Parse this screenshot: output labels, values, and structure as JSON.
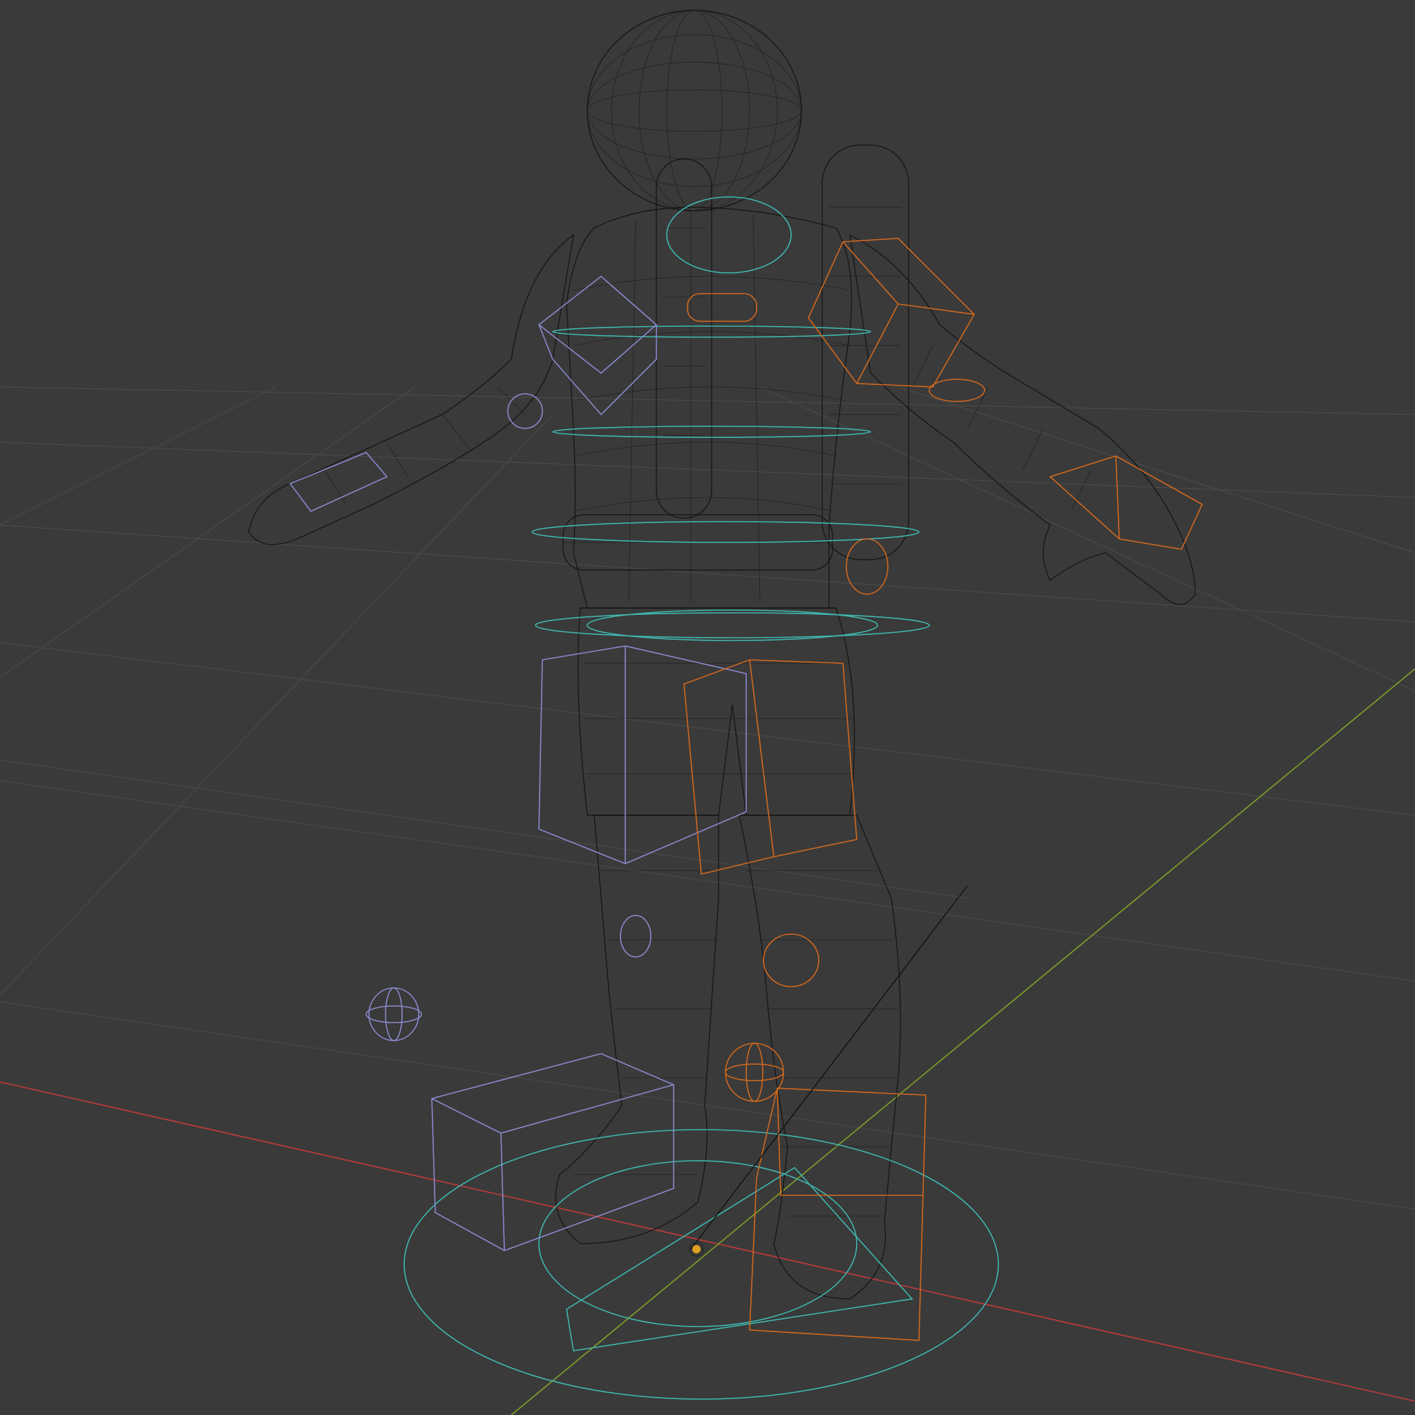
{
  "viewport": {
    "shading": "wireframe",
    "background_color": "#3a3a3a",
    "grid_color": "#4a4a4a",
    "mesh_wire_color": "#141414"
  },
  "axes": {
    "x_axis_color": "#b83a3a",
    "y_axis_color": "#7a9a2a"
  },
  "controls": {
    "left_side_color": "#8a8ad0",
    "right_side_color": "#d2691e",
    "center_color": "#3fb8b0"
  },
  "origin": {
    "marker_color": "#e0a020"
  }
}
